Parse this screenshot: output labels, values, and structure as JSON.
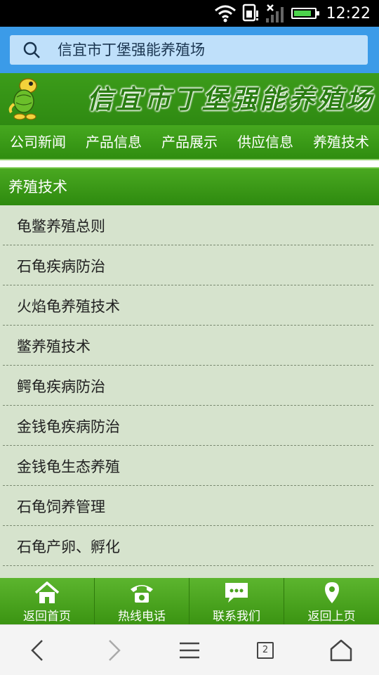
{
  "status_bar": {
    "time": "12:22",
    "battery_level": 0.85,
    "icons": [
      "wifi-icon",
      "sim-alert-icon",
      "signal-icon",
      "battery-icon"
    ]
  },
  "search": {
    "text": "信宜市丁堡强能养殖场",
    "icon": "search-icon"
  },
  "banner": {
    "title": "信宜市丁堡强能养殖场"
  },
  "nav": {
    "items": [
      "公司新闻",
      "产品信息",
      "产品展示",
      "供应信息",
      "养殖技术"
    ]
  },
  "section": {
    "title": "养殖技术"
  },
  "list": {
    "items": [
      "龟鳖养殖总则",
      "石龟疾病防治",
      "火焰龟养殖技术",
      "鳖养殖技术",
      "鳄龟疾病防治",
      "金钱龟疾病防治",
      "金钱龟生态养殖",
      "石龟饲养管理",
      "石龟产卵、孵化"
    ]
  },
  "toolbar": {
    "items": [
      {
        "label": "返回首页",
        "icon": "home-icon"
      },
      {
        "label": "热线电话",
        "icon": "phone-icon"
      },
      {
        "label": "联系我们",
        "icon": "chat-icon"
      },
      {
        "label": "返回上页",
        "icon": "location-pin-icon"
      }
    ]
  },
  "browser": {
    "tab_count": "2",
    "buttons": [
      "back-icon",
      "forward-icon",
      "menu-icon",
      "tabs-icon",
      "home-icon"
    ]
  },
  "colors": {
    "search_bg": "#3b9be8",
    "green_primary": "#3c9c1a",
    "list_bg": "#d6e3cd"
  }
}
